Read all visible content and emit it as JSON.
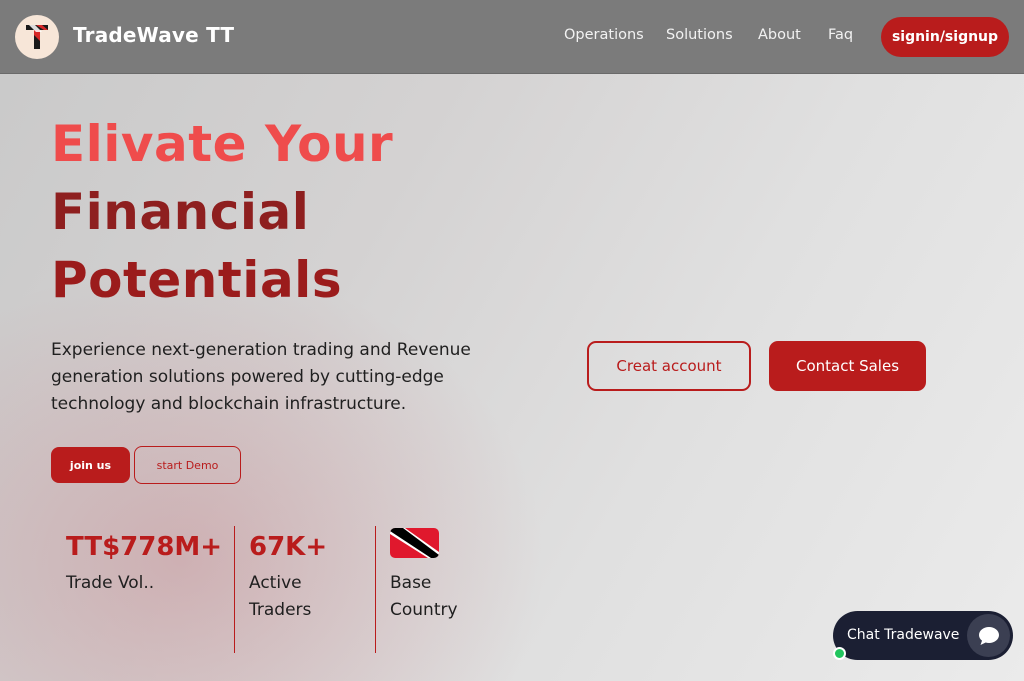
{
  "navbar": {
    "brand": "TradeWave TT",
    "links": [
      "Operations",
      "Solutions",
      "About",
      "Faq"
    ],
    "signin_label": "signin/signup"
  },
  "hero": {
    "line1": "Elivate Your",
    "line2": "Financial",
    "line3": "Potentials",
    "description": "Experience next-generation trading and Revenue generation solutions powered by cutting-edge technology and blockchain infrastructure.",
    "join_label": "join us",
    "demo_label": "start Demo",
    "creat_account_label": "Creat account",
    "contact_sales_label": "Contact Sales"
  },
  "stats": [
    {
      "value": "TT$778M+",
      "label": "Trade Vol.."
    },
    {
      "value": "67K+",
      "label": "Active Traders"
    },
    {
      "icon": "trinidad-tobago-flag",
      "label": "Base Country"
    }
  ],
  "chat": {
    "label": "Chat Tradewave",
    "icon": "chat-bubble-icon",
    "status": "online"
  },
  "colors": {
    "accent": "#b91c1c",
    "hero_highlight": "#ef4c4c",
    "navbar_bg": "#7b7b7b",
    "chat_bg": "#1b1f33",
    "online": "#22c55e"
  }
}
